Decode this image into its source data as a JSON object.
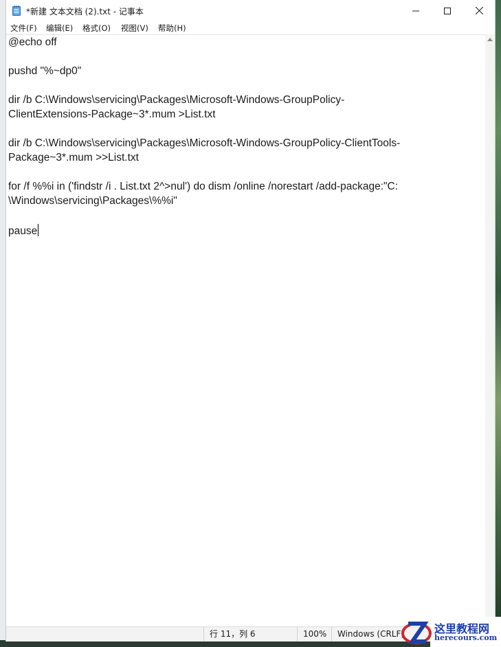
{
  "window": {
    "title": "*新建 文本文档 (2).txt - 记事本",
    "app_icon": "notepad-icon",
    "controls": {
      "minimize": "minimize-icon",
      "maximize": "maximize-icon",
      "close": "close-icon"
    }
  },
  "menu": {
    "items": [
      {
        "label": "文件(F)"
      },
      {
        "label": "编辑(E)"
      },
      {
        "label": "格式(O)"
      },
      {
        "label": "视图(V)"
      },
      {
        "label": "帮助(H)"
      }
    ]
  },
  "editor": {
    "lines": [
      "@echo off",
      "",
      "pushd \"%~dp0\"",
      "",
      "dir /b C:\\Windows\\servicing\\Packages\\Microsoft-Windows-GroupPolicy-",
      "ClientExtensions-Package~3*.mum >List.txt",
      "",
      "dir /b C:\\Windows\\servicing\\Packages\\Microsoft-Windows-GroupPolicy-ClientTools-",
      "Package~3*.mum >>List.txt",
      "",
      "for /f %%i in ('findstr /i . List.txt 2^>nul') do dism /online /norestart /add-package:\"C:",
      "\\Windows\\servicing\\Packages\\%%i\"",
      "",
      "pause"
    ]
  },
  "status": {
    "position": "行 11，列 6",
    "zoom": "100%",
    "line_ending": "Windows (CRLF)"
  },
  "watermark": {
    "title": "这里教程网",
    "url": "herecours.com"
  }
}
